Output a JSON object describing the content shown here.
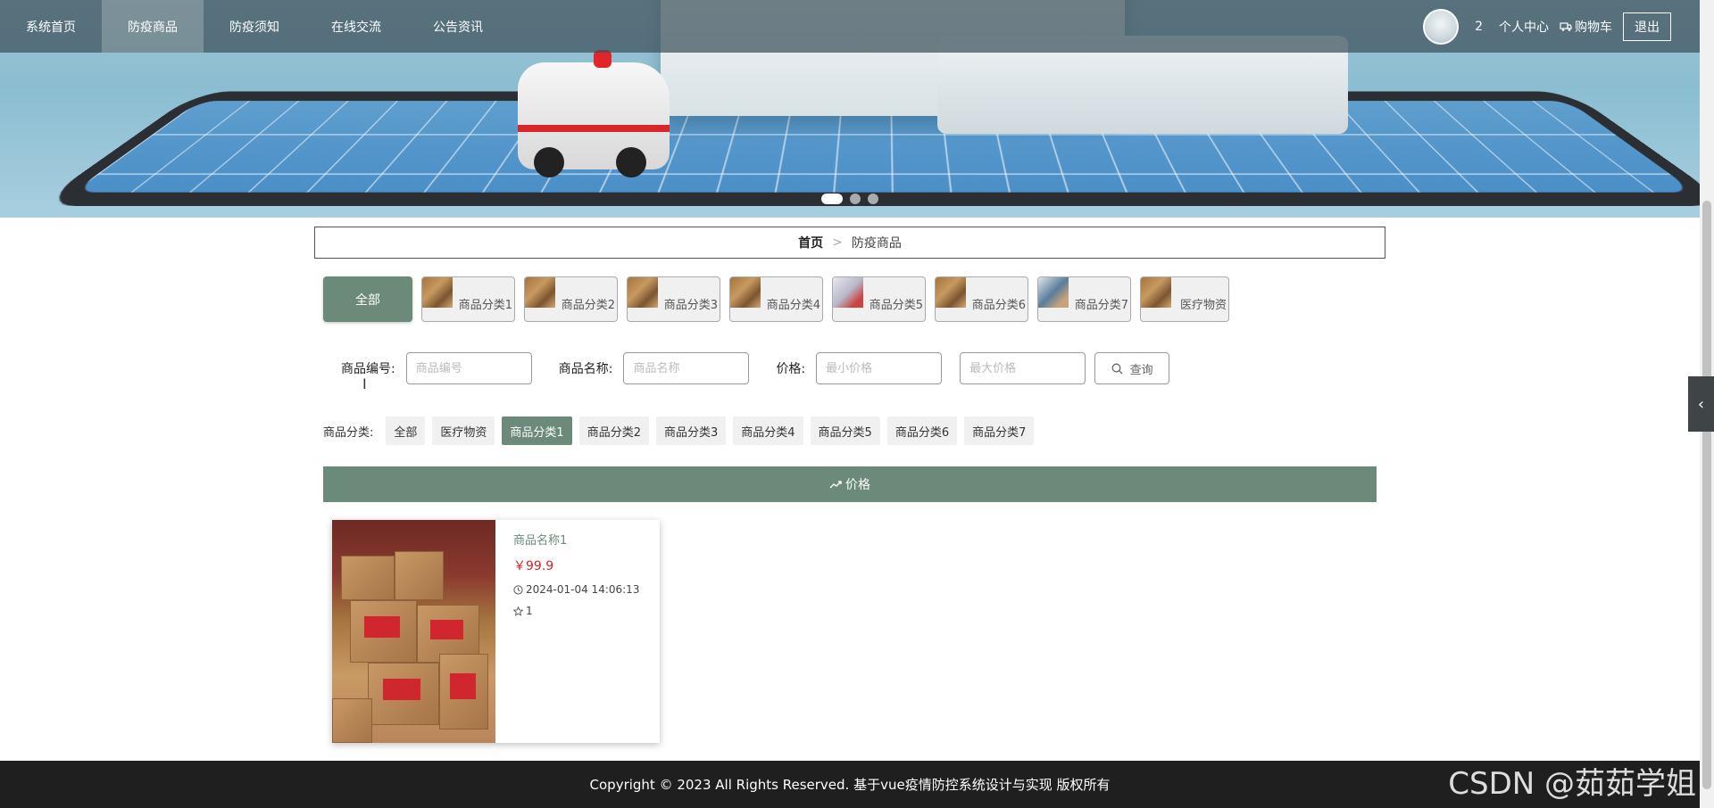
{
  "nav": {
    "items": [
      {
        "label": "系统首页",
        "active": false
      },
      {
        "label": "防疫商品",
        "active": true
      },
      {
        "label": "防疫须知",
        "active": false
      },
      {
        "label": "在线交流",
        "active": false
      },
      {
        "label": "公告资讯",
        "active": false
      }
    ],
    "user_count": "2",
    "profile_label": "个人中心",
    "cart_label": "购物车",
    "logout_label": "退出",
    "cart_icon": "truck-icon"
  },
  "banner": {
    "slides": 3,
    "active_slide": 0
  },
  "breadcrumb": {
    "home": "首页",
    "separator": ">",
    "current": "防疫商品"
  },
  "category_cards": {
    "all_label": "全部",
    "items": [
      "商品分类1",
      "商品分类2",
      "商品分类3",
      "商品分类4",
      "商品分类5",
      "商品分类6",
      "商品分类7",
      "医疗物资"
    ]
  },
  "search": {
    "code_label": "商品编号:",
    "code_placeholder": "商品编号",
    "name_label": "商品名称:",
    "name_placeholder": "商品名称",
    "price_label": "价格:",
    "min_price_placeholder": "最小价格",
    "max_price_placeholder": "最大价格",
    "button_label": "查询",
    "button_icon": "search-icon"
  },
  "filter": {
    "label": "商品分类:",
    "tabs": [
      {
        "label": "全部",
        "active": false
      },
      {
        "label": "医疗物资",
        "active": false
      },
      {
        "label": "商品分类1",
        "active": true
      },
      {
        "label": "商品分类2",
        "active": false
      },
      {
        "label": "商品分类3",
        "active": false
      },
      {
        "label": "商品分类4",
        "active": false
      },
      {
        "label": "商品分类5",
        "active": false
      },
      {
        "label": "商品分类6",
        "active": false
      },
      {
        "label": "商品分类7",
        "active": false
      }
    ]
  },
  "sort": {
    "label": "价格",
    "icon": "trend-up-icon"
  },
  "products": [
    {
      "name": "商品名称1",
      "price": "￥99.9",
      "time": "2024-01-04 14:06:13",
      "favorites": "1"
    }
  ],
  "footer": {
    "text": "Copyright © 2023 All Rights Reserved. 基于vue疫情防控系统设计与实现 版权所有"
  },
  "watermark": "CSDN @茹茹学姐",
  "colors": {
    "accent": "#6b8a7a",
    "price": "#d4232b",
    "footer_bg": "#1f1f1f"
  }
}
